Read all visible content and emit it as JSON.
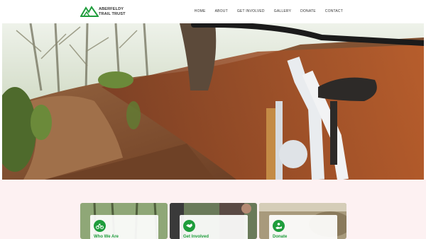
{
  "header": {
    "logo_line1": "ABERFELDY",
    "logo_line2": "TRAIL TRUST",
    "nav": [
      "HOME",
      "ABOUT",
      "GET INVOLVED",
      "GALLERY",
      "DONATE",
      "CONTACT"
    ]
  },
  "cards": [
    {
      "title": "Who We Are",
      "icon": "bicycle-icon"
    },
    {
      "title": "Get Involved",
      "icon": "handshake-icon"
    },
    {
      "title": "Donate",
      "icon": "donate-hand-icon"
    }
  ],
  "colors": {
    "accent": "#1f9d3c",
    "lower_bg": "#fdf1f2"
  }
}
